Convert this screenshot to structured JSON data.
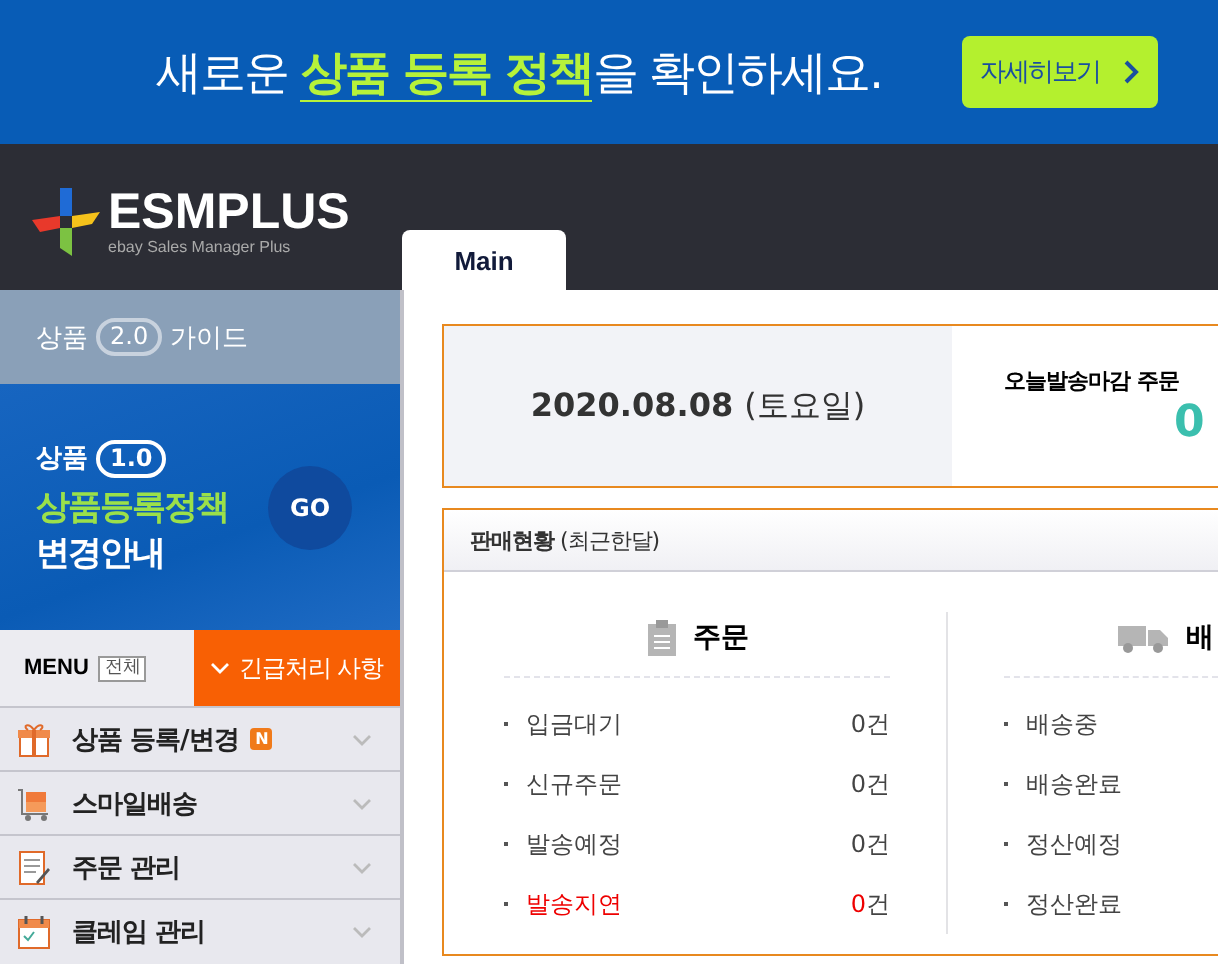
{
  "banner": {
    "text_before": "새로운 ",
    "highlight": "상품 등록 정책",
    "text_after": "을 확인하세요.",
    "button": "자세히보기"
  },
  "header": {
    "logo": "ESMPLUS",
    "tagline": "ebay Sales Manager Plus",
    "tabs": [
      {
        "label": "Main",
        "selected": true
      }
    ]
  },
  "sidebar": {
    "guide": {
      "before": "상품",
      "version": "2.0",
      "after": "가이드"
    },
    "promo": {
      "prefix": "상품",
      "version": "1.0",
      "title": "상품등록정책",
      "subtitle": "변경안내",
      "go": "GO"
    },
    "menu_label": "MENU",
    "all_button": "전체",
    "urgent": "긴급처리 사항",
    "items": [
      {
        "label": "상품 등록/변경",
        "kind": "gift",
        "badge": "N",
        "expanded": false
      },
      {
        "label": "스마일배송",
        "kind": "cart",
        "expanded": false
      },
      {
        "label": "주문 관리",
        "kind": "note",
        "expanded": false
      },
      {
        "label": "클레임 관리",
        "kind": "calendar",
        "expanded": false
      }
    ]
  },
  "today": {
    "date": "2020.08.08",
    "weekday": "(토요일)",
    "deadline_label": "오늘발송마감 주문",
    "deadline_count": "0"
  },
  "sales": {
    "title": "판매현황",
    "period": "(최근한달)",
    "columns": [
      {
        "title": "주문",
        "kind": "clipboard",
        "rows": [
          {
            "label": "입금대기",
            "count": "0",
            "unit": "건",
            "alert": false
          },
          {
            "label": "신규주문",
            "count": "0",
            "unit": "건",
            "alert": false
          },
          {
            "label": "발송예정",
            "count": "0",
            "unit": "건",
            "alert": false
          },
          {
            "label": "발송지연",
            "count": "0",
            "unit": "건",
            "alert": true
          }
        ]
      },
      {
        "title": "배",
        "kind": "truck",
        "rows": [
          {
            "label": "배송중"
          },
          {
            "label": "배송완료"
          },
          {
            "label": "정산예정"
          },
          {
            "label": "정산완료"
          }
        ]
      }
    ]
  }
}
